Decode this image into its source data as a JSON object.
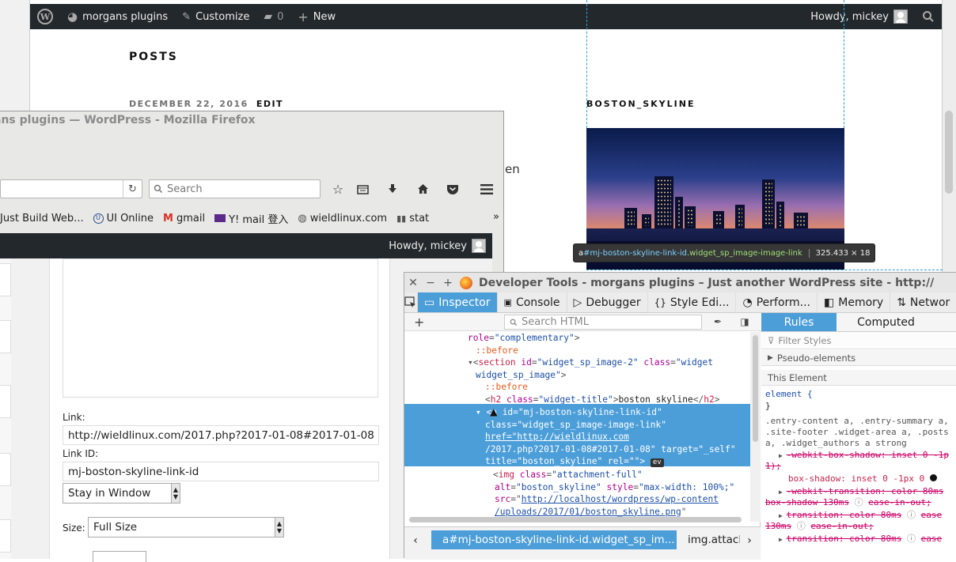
{
  "wp": {
    "adminbar": {
      "site_name": "morgans plugins",
      "customize": "Customize",
      "comments": "0",
      "new": "New",
      "howdy": "Howdy, mickey"
    },
    "posts_heading": "POSTS",
    "post_date": "DECEMBER 22, 2016",
    "post_edit": "EDIT",
    "text_fragment": "en",
    "widget_title": "BOSTON_SKYLINE",
    "tooltip": {
      "selector_prefix": "a",
      "selector_id": "#mj-boston-skyline-link-id",
      "selector_class": ".widget_sp_image-image-link",
      "dims": "325.433 × 18"
    }
  },
  "firefox": {
    "title": "ans plugins — WordPress - Mozilla Firefox",
    "search_placeholder": "Search",
    "bookmarks": [
      "Just Build Web...",
      "UI Online",
      "gmail",
      "Y! mail 登入",
      "wieldlinux.com",
      "stat"
    ],
    "overflow": "»",
    "howdy": "Howdy, mickey",
    "form": {
      "link_label": "Link:",
      "link_value": "http://wieldlinux.com/2017.php?2017-01-08#2017-01-08",
      "link_id_label": "Link ID:",
      "link_id_value": "mj-boston-skyline-link-id",
      "target_value": "Stay in Window",
      "size_label": "Size:",
      "size_value": "Full Size"
    }
  },
  "devtools": {
    "title": "Developer Tools - morgans plugins – Just another WordPress site - http://",
    "tabs": [
      "Inspector",
      "Console",
      "Debugger",
      "Style Edi...",
      "Perform...",
      "Memory",
      "Networ"
    ],
    "search_placeholder": "Search HTML",
    "rules_tab": "Rules",
    "computed_tab": "Computed",
    "filter_placeholder": "Filter Styles",
    "pseudo_elements": "Pseudo-elements",
    "this_element": "This Element",
    "breadcrumb_active": "a#mj-boston-skyline-link-id.widget_sp_im...",
    "breadcrumb_next": "img.attacl",
    "markup": {
      "l1": {
        "a": "role",
        "v": "\"complementary\""
      },
      "l2": "::before",
      "l3": {
        "tag": "section",
        "id_a": "id",
        "id_v": "\"widget_sp_image-2\"",
        "cls_a": "class",
        "cls_v": "\"widget"
      },
      "l4": "widget_sp_image\"",
      "l5": "::before",
      "l6": {
        "tag": "h2",
        "cls_a": "class",
        "cls_v": "\"widget-title\"",
        "text": "boston_skyline"
      },
      "s1": "id=\"mj-boston-skyline-link-id\"",
      "s2": "class=\"widget_sp_image-image-link\"",
      "s3": "href=\"http://wieldlinux.com",
      "s4": "/2017.php?2017-01-08#2017-01-08\" target=\"_self\"",
      "s5": "title=\"boston_skyline\" rel=\"\">",
      "ev": "ev",
      "l7": {
        "tag": "img",
        "a": "class",
        "v": "\"attachment-full\""
      },
      "l8": {
        "a1": "alt",
        "v1": "\"boston_skyline\"",
        "a2": "style",
        "v2": "\"max-width: 100%;\""
      },
      "l9": {
        "a": "src",
        "v": "http://localhost/wordpress/wp-content"
      },
      "l10": "/uploads/2017/01/boston_skyline.png"
    },
    "rules": {
      "element": "element {",
      "close": "}",
      "sel1": ".entry-content a, .entry-summary a,",
      "sel2": ".site-footer .widget-area a, .posts",
      "sel3": "a, .widget_authors a strong",
      "r1": "-webkit-box-shadow: inset 0 -1p",
      "r1b": "1);",
      "r2": "box-shadow: inset 0 -1px 0",
      "r3": "-webkit-transition: color 80ms",
      "r3b": "box-shadow 130ms",
      "r3c": "ease-in-out;",
      "r4": "transition: color 80ms",
      "r4b": "ease",
      "r4c": "130ms",
      "r4d": "ease-in-out;",
      "r5": "transition: color 80ms",
      "r5b": "ease"
    }
  }
}
